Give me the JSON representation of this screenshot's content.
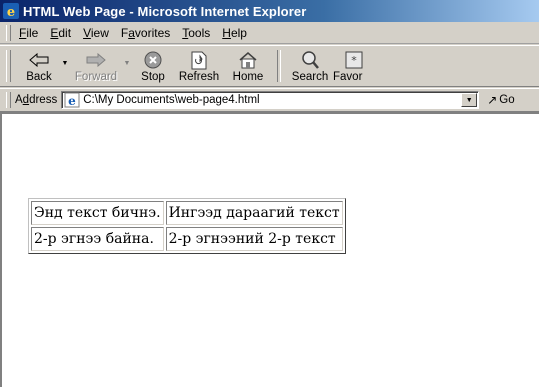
{
  "window": {
    "title": "HTML Web Page - Microsoft Internet Explorer"
  },
  "menu": {
    "items": [
      {
        "key": "F",
        "rest": "ile"
      },
      {
        "key": "E",
        "rest": "dit"
      },
      {
        "key": "V",
        "rest": "iew"
      },
      {
        "pre": "F",
        "key": "a",
        "rest": "vorites"
      },
      {
        "key": "T",
        "rest": "ools"
      },
      {
        "key": "H",
        "rest": "elp"
      }
    ]
  },
  "toolbar": {
    "back": "Back",
    "forward": "Forward",
    "stop": "Stop",
    "refresh": "Refresh",
    "home": "Home",
    "search": "Search",
    "favorites": "Favor"
  },
  "address": {
    "label_pre": "A",
    "label_key": "d",
    "label_rest": "dress",
    "value": "C:\\My Documents\\web-page4.html",
    "go": "Go"
  },
  "table": {
    "rows": [
      [
        "Энд текст бичнэ.",
        "Ингээд дараагий текст"
      ],
      [
        "2-р эгнээ байна.",
        "2-р эгнээний 2-р текст"
      ]
    ]
  },
  "icons": {
    "app": "ie-logo-icon",
    "back": "back-arrow-icon",
    "forward": "forward-arrow-icon",
    "stop": "stop-icon",
    "refresh": "refresh-icon",
    "home": "home-icon",
    "search": "search-icon",
    "favorites": "favorites-icon"
  }
}
